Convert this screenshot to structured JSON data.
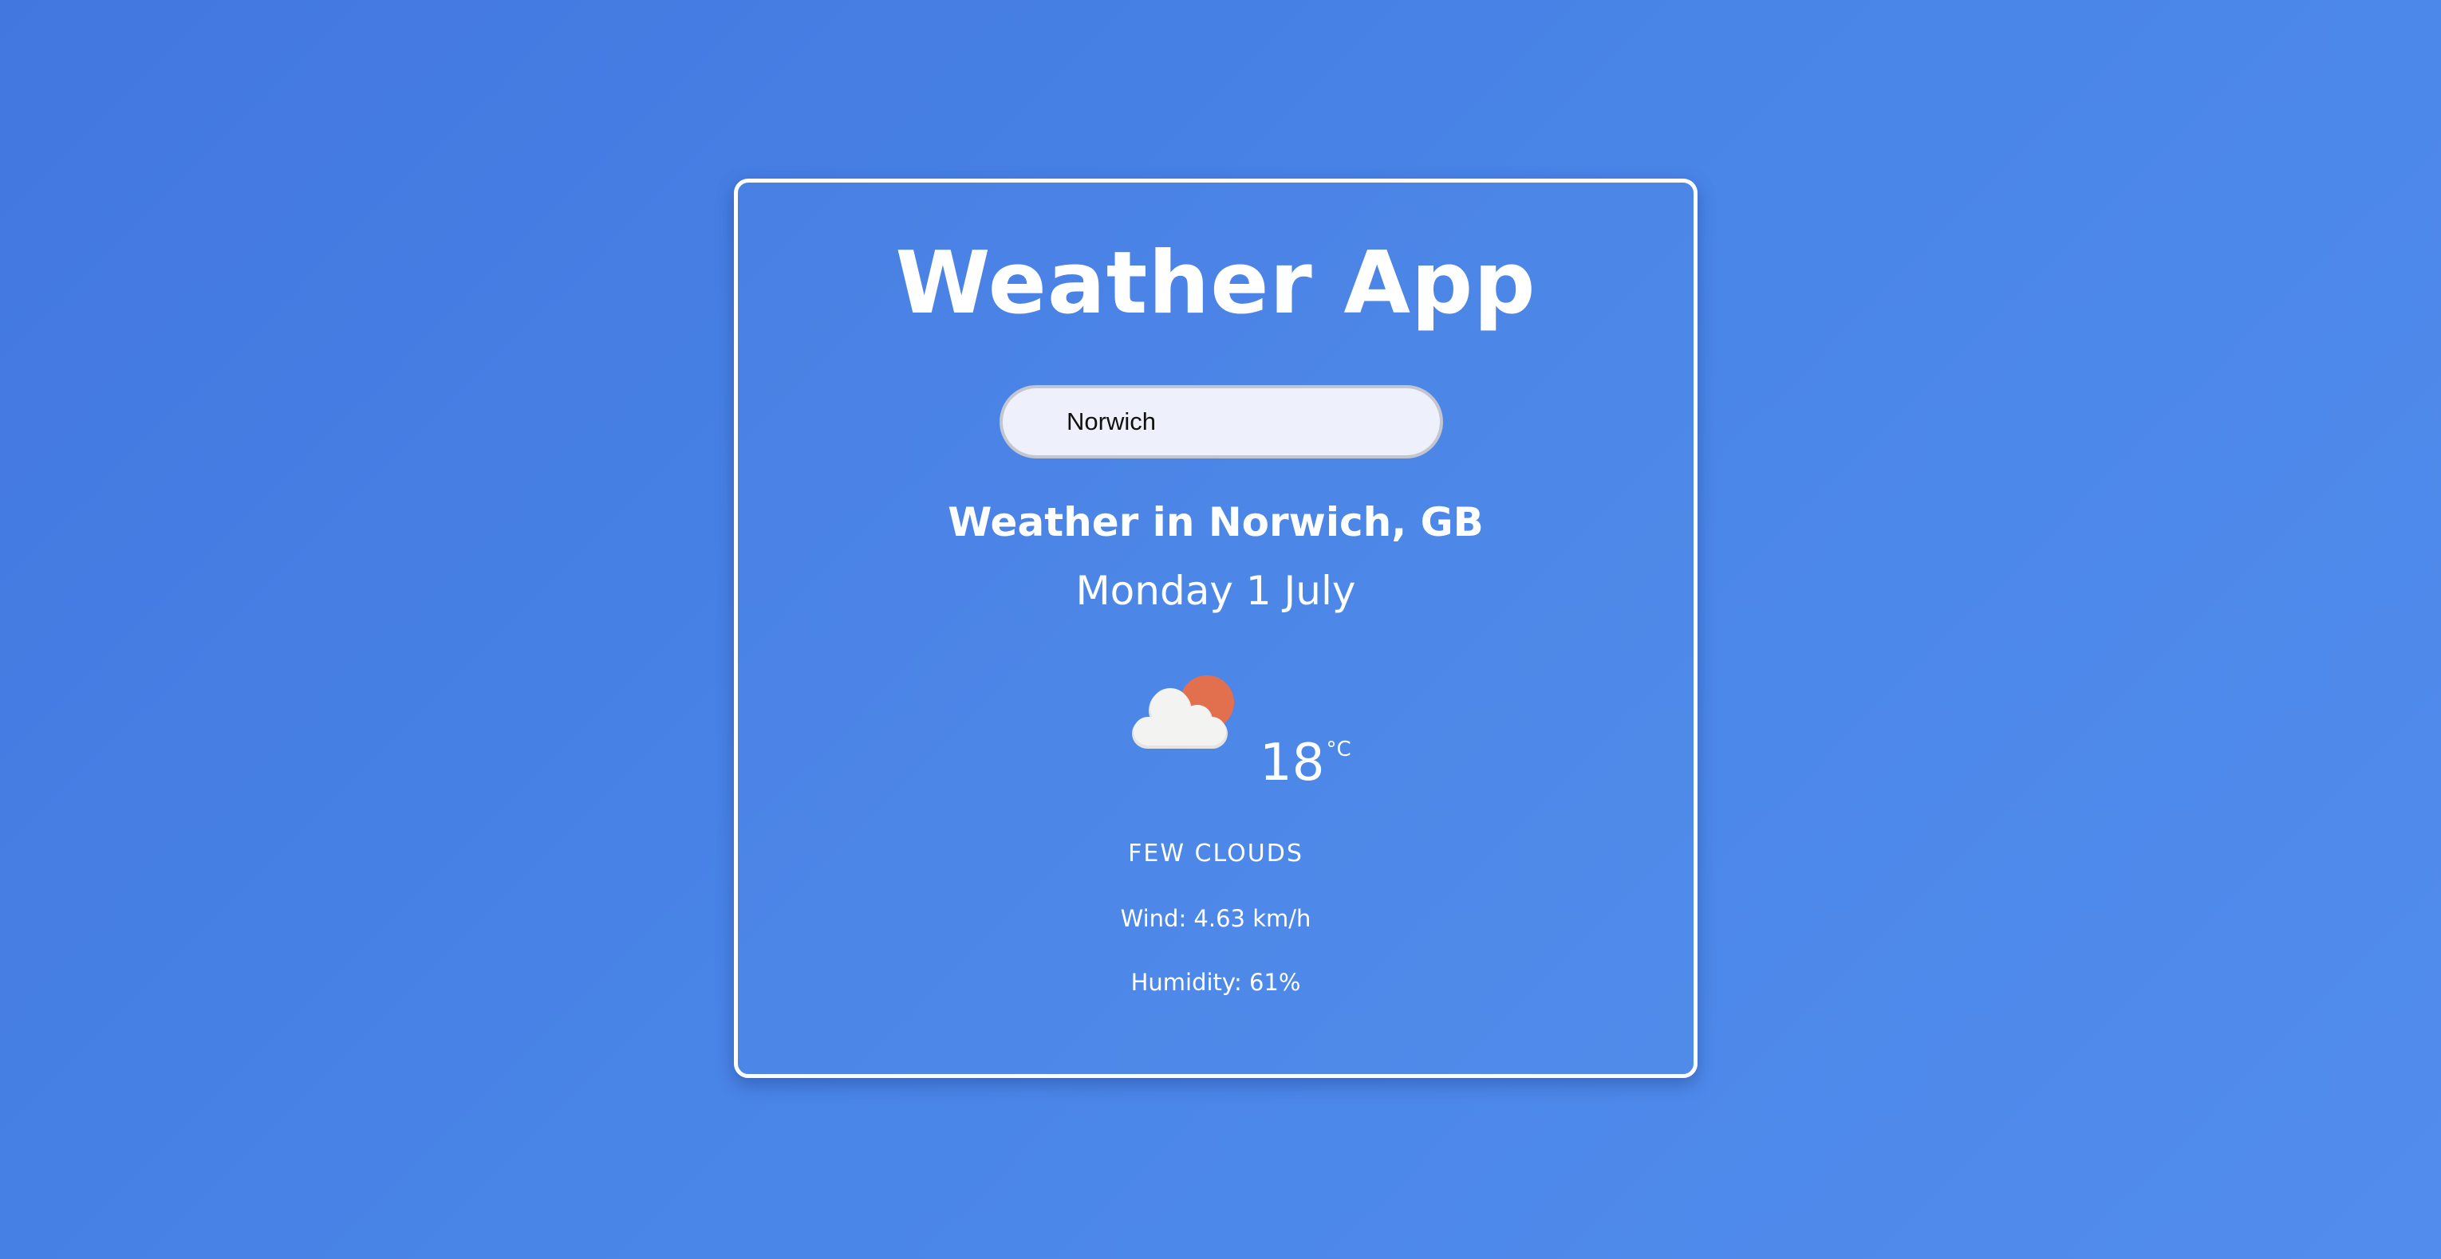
{
  "app": {
    "title": "Weather App"
  },
  "search": {
    "value": "Norwich",
    "placeholder": ""
  },
  "weather": {
    "location_heading": "Weather in Norwich, GB",
    "date": "Monday 1 July",
    "icon": "few-clouds-icon",
    "temperature": "18",
    "temperature_unit": "°C",
    "description": "FEW CLOUDS",
    "wind": "Wind: 4.63 km/h",
    "humidity": "Humidity: 61%"
  },
  "colors": {
    "background": "#4a86e8",
    "card_border": "#ffffff",
    "text": "#ffffff",
    "search_background": "#eef1fb",
    "sun": "#e2704f",
    "cloud": "#f3f3f1"
  }
}
